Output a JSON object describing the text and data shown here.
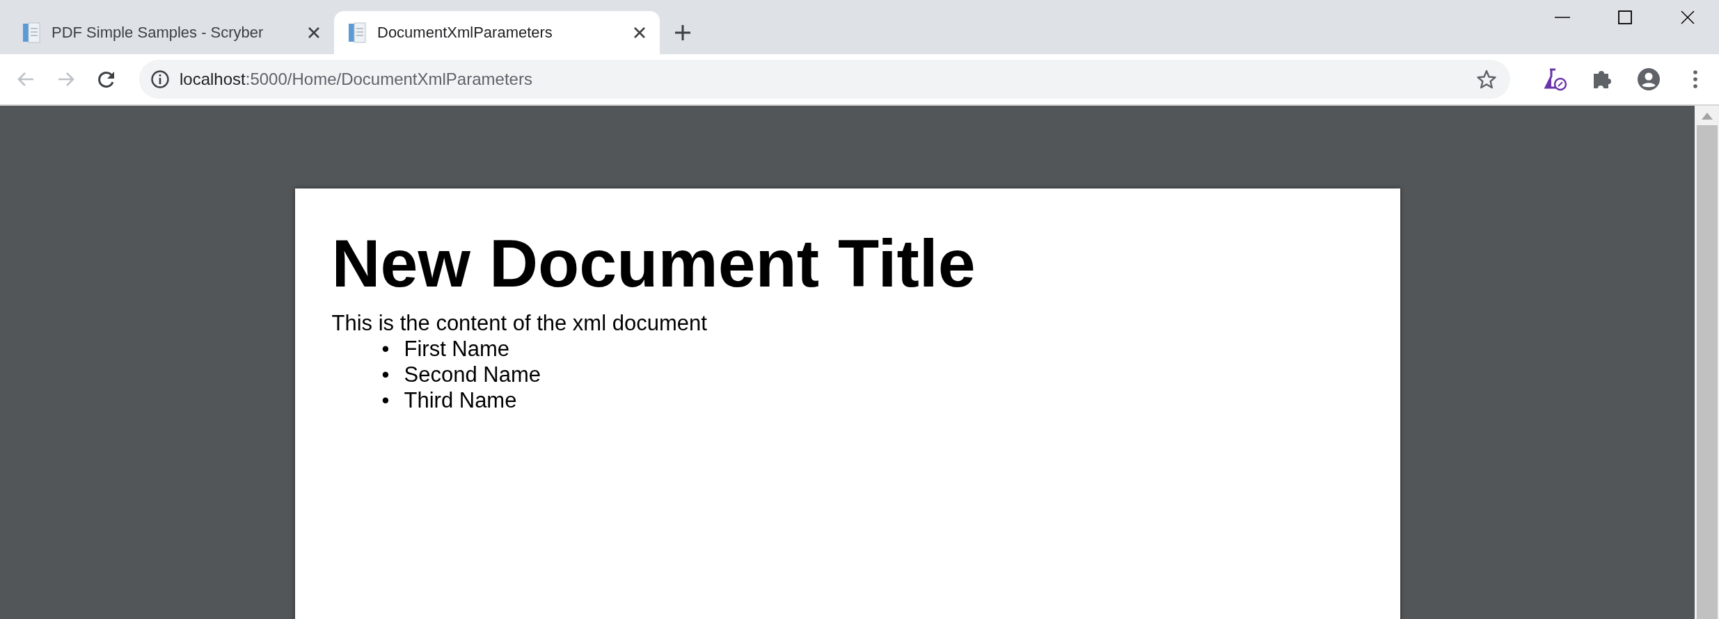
{
  "tabs": [
    {
      "title": "PDF Simple Samples - Scryber",
      "selected": false
    },
    {
      "title": "DocumentXmlParameters",
      "selected": true
    }
  ],
  "address_bar": {
    "host": "localhost",
    "path": ":5000/Home/DocumentXmlParameters"
  },
  "navigation": {
    "back_disabled": true,
    "forward_disabled": true
  },
  "document": {
    "title": "New Document Title",
    "paragraph": "This is the content of the xml document",
    "list": [
      {
        "marker": "•",
        "text": "First Name"
      },
      {
        "marker": "•",
        "text": "Second Name"
      },
      {
        "marker": "•",
        "text": "Third Name"
      }
    ]
  }
}
